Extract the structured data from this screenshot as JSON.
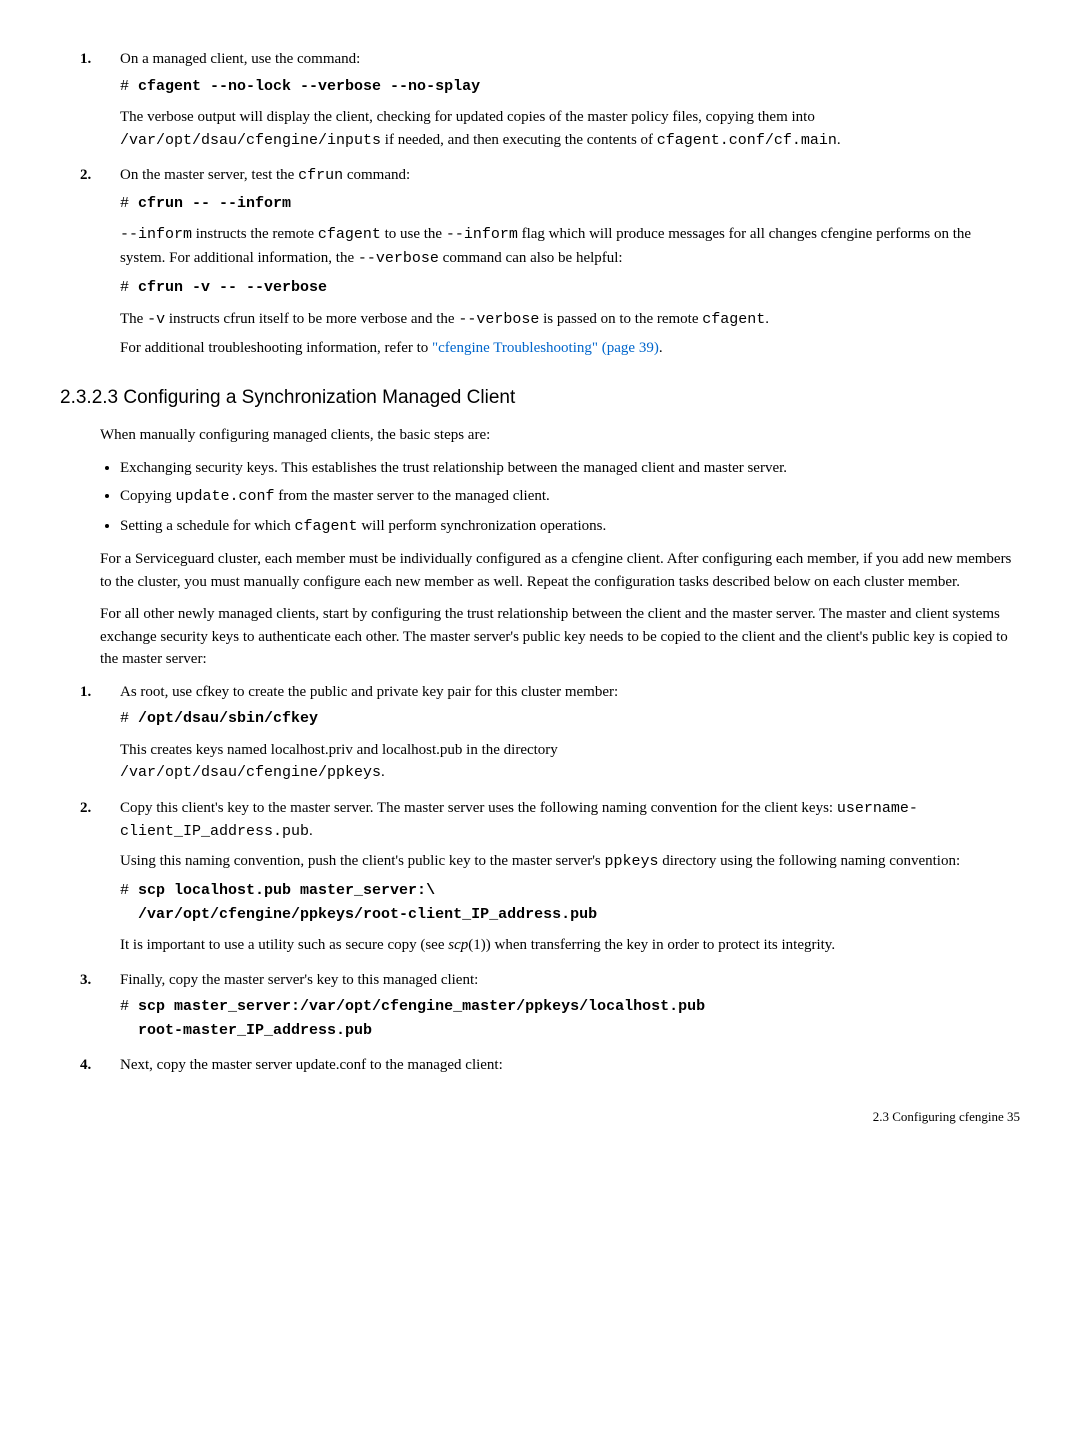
{
  "step1": {
    "num": "1.",
    "intro": "On a managed client, use the command:",
    "cmd_hash": "# ",
    "cmd": "cfagent --no-lock --verbose --no-splay",
    "p1a": "The verbose output will display the client, checking for updated copies of the master policy files, copying them into ",
    "p1b": "/var/opt/dsau/cfengine/inputs",
    "p1c": " if needed, and then executing the contents of ",
    "p1d": "cfagent.conf/cf.main",
    "p1e": "."
  },
  "step2": {
    "num": "2.",
    "intro_a": "On the master server, test the ",
    "intro_b": "cfrun",
    "intro_c": " command:",
    "cmd1_hash": "# ",
    "cmd1": "cfrun -- --inform",
    "p1a": "--inform",
    "p1b": " instructs the remote ",
    "p1c": "cfagent",
    "p1d": " to use the ",
    "p1e": "--inform",
    "p1f": " flag which will produce messages for all changes cfengine performs on the system. For additional information, the ",
    "p1g": "--verbose",
    "p1h": " command can also be helpful:",
    "cmd2_hash": "# ",
    "cmd2": "cfrun -v -- --verbose",
    "p2a": "The ",
    "p2b": "-v",
    "p2c": " instructs cfrun itself to be more verbose and the ",
    "p2d": "--verbose",
    "p2e": " is passed on to the remote ",
    "p2f": "cfagent",
    "p2g": ".",
    "p3a": "For additional troubleshooting information, refer to ",
    "p3b": "\"cfengine Troubleshooting\" (page 39)",
    "p3c": "."
  },
  "section": {
    "heading": "2.3.2.3 Configuring a Synchronization Managed Client",
    "intro": "When manually configuring managed clients, the basic steps are:",
    "bullet1": "Exchanging  security keys. This establishes the trust relationship between the managed client and master server.",
    "bullet2a": "Copying ",
    "bullet2b": "update.conf",
    "bullet2c": " from the master server to the managed client.",
    "bullet3a": "Setting a schedule for which ",
    "bullet3b": "cfagent",
    "bullet3c": " will perform synchronization operations.",
    "para1": "For a Serviceguard cluster, each member must be individually configured as a cfengine client. After configuring each member, if you add new members to the cluster, you must manually configure each new member as well. Repeat the configuration tasks described below on each cluster member.",
    "para2": "For all other newly managed clients, start by configuring the trust relationship between the client and the master server. The master and client systems exchange security keys to authenticate each other. The master server's public key needs to be copied to the client and the client's public key is copied to the master server:"
  },
  "nsteps": {
    "s1": {
      "num": "1.",
      "intro": "As root, use cfkey to create the public and private key pair for this cluster member:",
      "cmd_hash": "# ",
      "cmd": "/opt/dsau/sbin/cfkey",
      "p1a": "This creates keys named localhost.priv and localhost.pub in the directory ",
      "p1b": "/var/opt/dsau/cfengine/ppkeys",
      "p1c": "."
    },
    "s2": {
      "num": "2.",
      "intro_a": "Copy this client's key to the master server. The master server uses the following naming convention for the client keys: ",
      "intro_b": "username-client_IP_address.pub",
      "intro_c": ".",
      "p1a": "Using this naming convention, push the client's public key to the master server's ",
      "p1b": "ppkeys",
      "p1c": " directory using the following naming convention:",
      "cmd_hash": "# ",
      "cmd_l1": "scp localhost.pub master_server:\\",
      "cmd_indent": "  ",
      "cmd_l2": "/var/opt/cfengine/ppkeys/root-client_IP_address.pub",
      "p2a": "It is important to use a utility such as  secure copy (see ",
      "p2b": "scp",
      "p2c": "(1)) when transferring the key in order to protect its integrity."
    },
    "s3": {
      "num": "3.",
      "intro": "Finally, copy the master server's key to this managed client:",
      "cmd_hash": "# ",
      "cmd_l1": "scp master_server:/var/opt/cfengine_master/ppkeys/localhost.pub",
      "cmd_indent": "  ",
      "cmd_l2": "root-master_IP_address.pub"
    },
    "s4": {
      "num": "4.",
      "intro": "Next, copy the master server update.conf to the managed client:"
    }
  },
  "footer": {
    "text": "2.3 Configuring cfengine     35"
  }
}
